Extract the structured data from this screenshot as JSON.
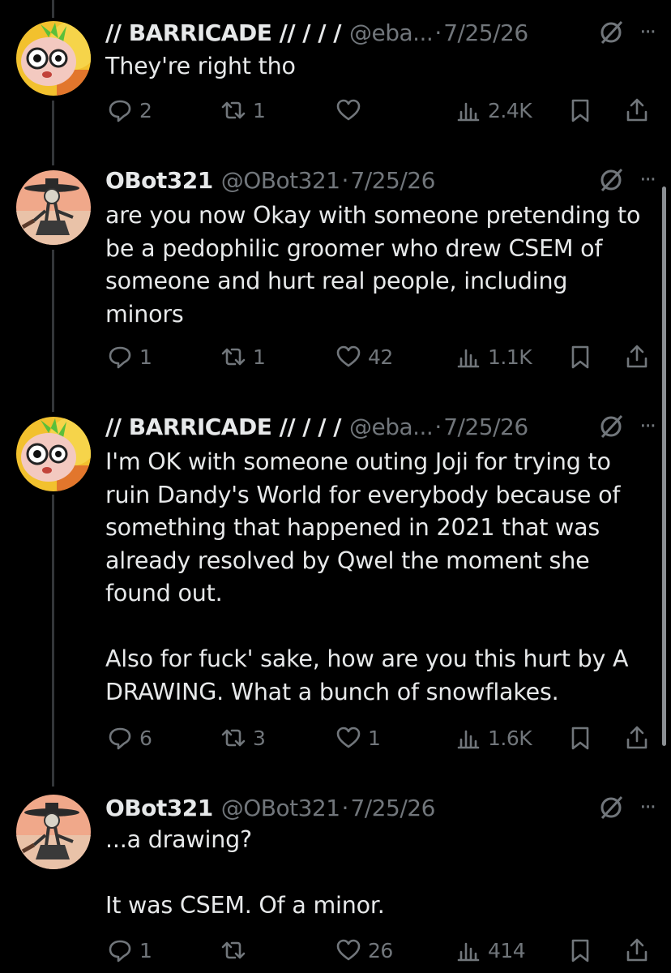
{
  "tweets": [
    {
      "name": "// BARRICADE // / / /",
      "handle": "@eba...",
      "dot": "·",
      "date": "7/25/26",
      "more": "···",
      "text": "They're right tho",
      "replies": "2",
      "retweets": "1",
      "likes": "",
      "views": "2.4K",
      "avatar": "cartoon-character-avatar"
    },
    {
      "name": "OBot321",
      "handle": "@OBot321",
      "dot": "·",
      "date": "7/25/26",
      "more": "···",
      "text": "are you now Okay with someone pretending to\nbe a pedophilic groomer who drew CSEM of\nsomeone and hurt real people, including\nminors",
      "replies": "1",
      "retweets": "1",
      "likes": "42",
      "views": "1.1K",
      "avatar": "skeleton-art-avatar"
    },
    {
      "name": "// BARRICADE // / / /",
      "handle": "@eba...",
      "dot": "·",
      "date": "7/25/26",
      "more": "···",
      "text": "I'm OK with someone outing Joji for trying to\nruin Dandy's World for everybody because of\nsomething that happened in 2021 that was\nalready resolved by Qwel the moment she\nfound out.\n\nAlso for fuck' sake, how are you this hurt by A\nDRAWING. What a bunch of snowflakes.",
      "replies": "6",
      "retweets": "3",
      "likes": "1",
      "views": "1.6K",
      "avatar": "cartoon-character-avatar"
    },
    {
      "name": "OBot321",
      "handle": "@OBot321",
      "dot": "·",
      "date": "7/25/26",
      "more": "···",
      "text": "...a drawing?\n\nIt was CSEM. Of a minor.",
      "replies": "1",
      "retweets": "",
      "likes": "26",
      "views": "414",
      "avatar": "skeleton-art-avatar"
    }
  ],
  "icons": {
    "reply": "reply-icon",
    "retweet": "retweet-icon",
    "like": "heart-icon",
    "views": "views-icon",
    "bookmark": "bookmark-icon",
    "share": "share-icon",
    "grok": "grok-icon",
    "more": "more-icon"
  },
  "colors": {
    "background": "#000000",
    "text": "#e7e9ea",
    "secondary": "#71767b",
    "thread_line": "#333639"
  }
}
